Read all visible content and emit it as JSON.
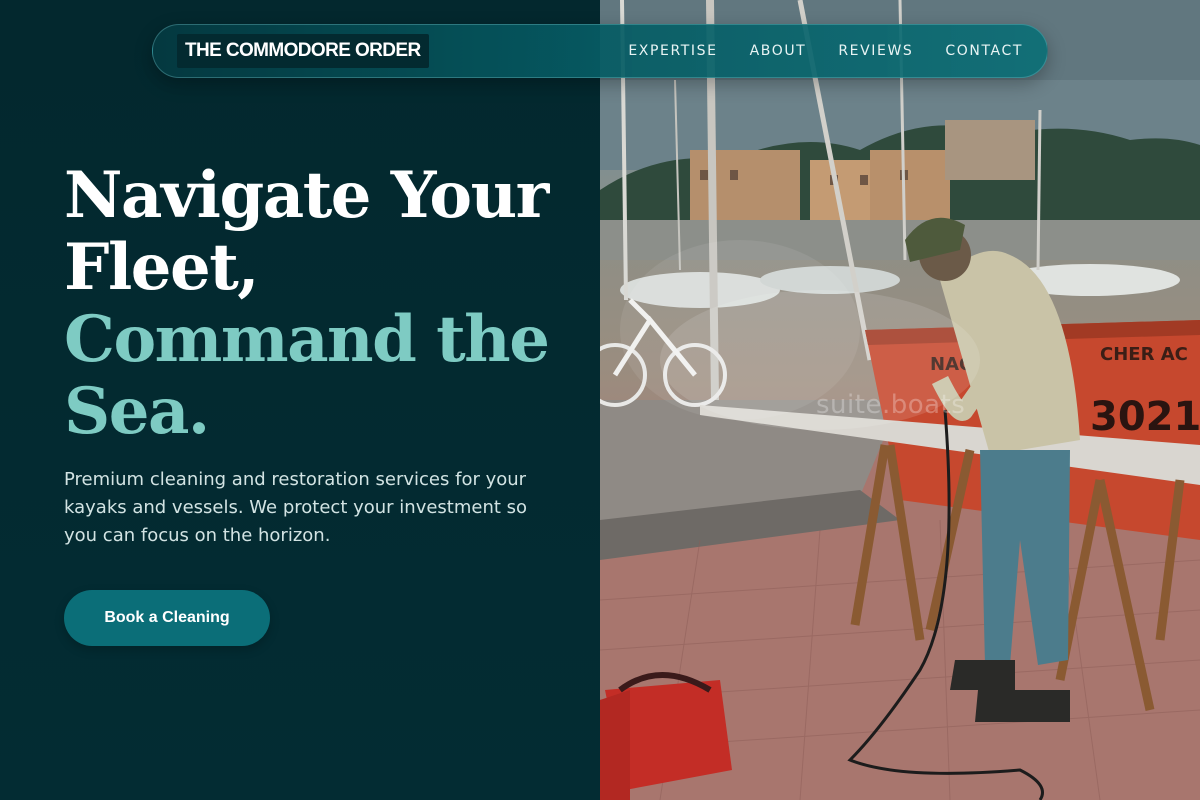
{
  "brand": {
    "name": "THE COMMODORE ORDER"
  },
  "nav": {
    "items": [
      {
        "label": "EXPERTISE"
      },
      {
        "label": "ABOUT"
      },
      {
        "label": "REVIEWS"
      },
      {
        "label": "CONTACT"
      }
    ]
  },
  "hero": {
    "title_line1": "Navigate Your Fleet,",
    "title_line2": "Command the Sea.",
    "description": "Premium cleaning and restoration services for your kayaks and vessels. We protect your investment so you can focus on the horizon.",
    "cta_label": "Book a Cleaning"
  },
  "photo": {
    "watermark": "suite.boats",
    "signs": {
      "bin_text_1": "NAO",
      "bin_text_2": "CHER AC",
      "bin_number": "3021"
    }
  },
  "colors": {
    "background": "#032b31",
    "accent": "#7ecbc3",
    "button": "#0b6e78",
    "navbar": "#065c64"
  }
}
